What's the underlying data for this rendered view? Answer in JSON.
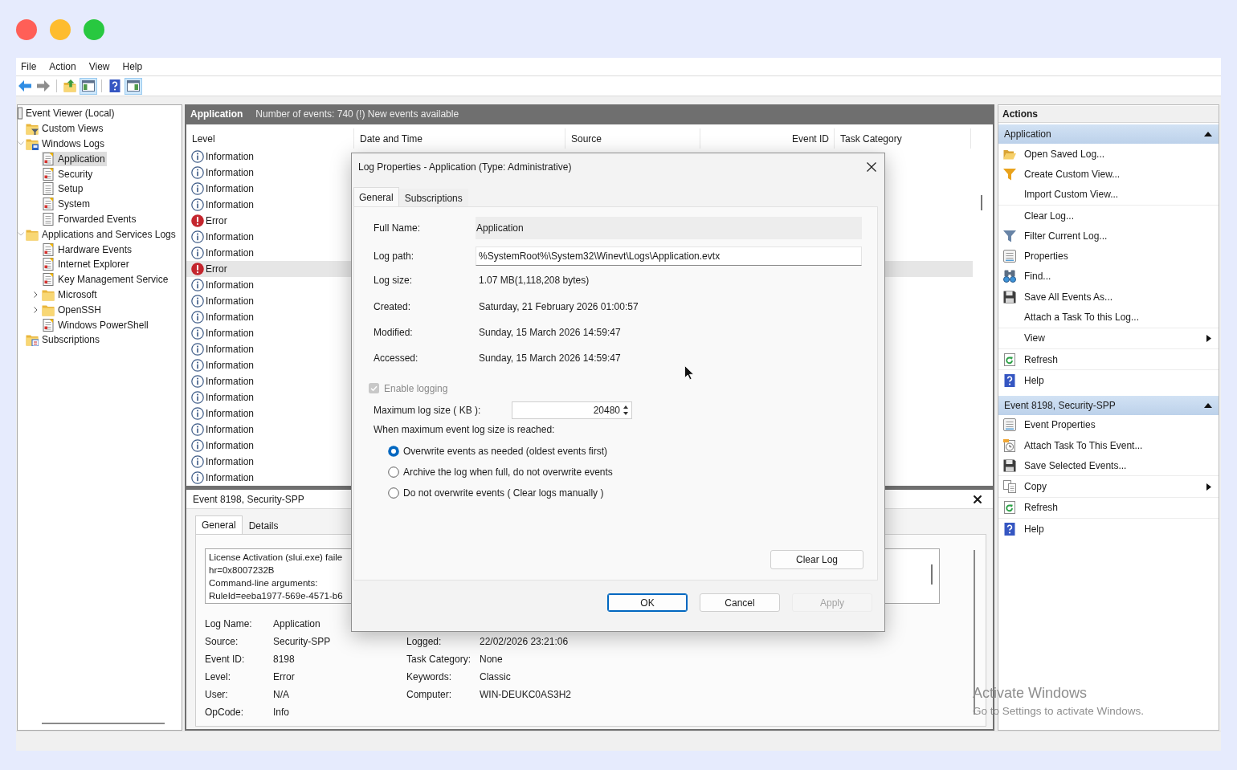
{
  "window_controls": [
    {
      "color": "#ff5f57"
    },
    {
      "color": "#febc2e"
    },
    {
      "color": "#28c840"
    }
  ],
  "menu_bar": [
    {
      "label": "File"
    },
    {
      "label": "Action"
    },
    {
      "label": "View"
    },
    {
      "label": "Help"
    }
  ],
  "toolbar": [
    {
      "pressed": false
    },
    {
      "pressed": false
    },
    {
      "pressed": false
    },
    {
      "pressed": true
    },
    {
      "pressed": false
    },
    {
      "pressed": true
    }
  ],
  "tree": {
    "label": "Event Viewer (Local)",
    "kind": "root",
    "selected": false,
    "children": [
      {
        "label": "Custom Views",
        "kind": "view-folder",
        "selected": false
      },
      {
        "label": "Windows Logs",
        "kind": "logs-folder",
        "selected": false,
        "expanded": true,
        "children": [
          {
            "label": "Application",
            "kind": "log",
            "selected": true
          },
          {
            "label": "Security",
            "kind": "log",
            "selected": false
          },
          {
            "label": "Setup",
            "kind": "blank-log",
            "selected": false
          },
          {
            "label": "System",
            "kind": "log",
            "selected": false
          },
          {
            "label": "Forwarded Events",
            "kind": "blank-log",
            "selected": false
          }
        ]
      },
      {
        "label": "Applications and Services Logs",
        "kind": "folder",
        "selected": false,
        "expanded": true,
        "children": [
          {
            "label": "Hardware Events",
            "kind": "log",
            "selected": false
          },
          {
            "label": "Internet Explorer",
            "kind": "log",
            "selected": false
          },
          {
            "label": "Key Management Service",
            "kind": "log",
            "selected": false
          },
          {
            "label": "Microsoft",
            "kind": "folder",
            "selected": false,
            "expanded": false
          },
          {
            "label": "OpenSSH",
            "kind": "folder",
            "selected": false,
            "expanded": false
          },
          {
            "label": "Windows PowerShell",
            "kind": "log",
            "selected": false
          }
        ]
      },
      {
        "label": "Subscriptions",
        "kind": "subscriptions",
        "selected": false
      }
    ]
  },
  "events_header": {
    "title": "Application",
    "summary": "Number of events: 740 (!) New events available"
  },
  "event_list": {
    "columns": [
      "Level",
      "Date and Time",
      "Source",
      "Event ID",
      "Task Category"
    ],
    "rows": [
      {
        "kind": "information",
        "text": "Information",
        "selected": false
      },
      {
        "kind": "information",
        "text": "Information",
        "selected": false
      },
      {
        "kind": "information",
        "text": "Information",
        "selected": false
      },
      {
        "kind": "information",
        "text": "Information",
        "selected": false
      },
      {
        "kind": "error",
        "text": "Error",
        "selected": false
      },
      {
        "kind": "information",
        "text": "Information",
        "selected": false
      },
      {
        "kind": "information",
        "text": "Information",
        "selected": false
      },
      {
        "kind": "error",
        "text": "Error",
        "selected": true
      },
      {
        "kind": "information",
        "text": "Information",
        "selected": false
      },
      {
        "kind": "information",
        "text": "Information",
        "selected": false
      },
      {
        "kind": "information",
        "text": "Information",
        "selected": false
      },
      {
        "kind": "information",
        "text": "Information",
        "selected": false
      },
      {
        "kind": "information",
        "text": "Information",
        "selected": false
      },
      {
        "kind": "information",
        "text": "Information",
        "selected": false
      },
      {
        "kind": "information",
        "text": "Information",
        "selected": false
      },
      {
        "kind": "information",
        "text": "Information",
        "selected": false
      },
      {
        "kind": "information",
        "text": "Information",
        "selected": false
      },
      {
        "kind": "information",
        "text": "Information",
        "selected": false
      },
      {
        "kind": "information",
        "text": "Information",
        "selected": false
      },
      {
        "kind": "information",
        "text": "Information",
        "selected": false
      },
      {
        "kind": "information",
        "text": "Information",
        "selected": false
      }
    ]
  },
  "event_detail": {
    "title": "Event 8198, Security-SPP",
    "tabs": [
      {
        "label": "General",
        "selected": true
      },
      {
        "label": "Details",
        "selected": false
      }
    ],
    "message": [
      "License Activation (slui.exe) faile",
      "hr=0x8007232B",
      "Command-line arguments:",
      "RuleId=eeba1977-569e-4571-b6"
    ],
    "fields_left": [
      {
        "label": "Log Name:",
        "value": "Application"
      },
      {
        "label": "Source:",
        "value": "Security-SPP"
      },
      {
        "label": "Event ID:",
        "value": "8198"
      },
      {
        "label": "Level:",
        "value": "Error"
      },
      {
        "label": "User:",
        "value": "N/A"
      },
      {
        "label": "OpCode:",
        "value": "Info"
      }
    ],
    "fields_right": [
      {
        "label": "Logged:",
        "value": "22/02/2026 23:21:06"
      },
      {
        "label": "Task Category:",
        "value": "None"
      },
      {
        "label": "Keywords:",
        "value": "Classic"
      },
      {
        "label": "Computer:",
        "value": "WIN-DEUKC0AS3H2"
      }
    ]
  },
  "actions": {
    "title": "Actions",
    "sections": [
      {
        "title": "Application",
        "expanded": true,
        "groups": [
          [
            {
              "label": "Open Saved Log...",
              "submenu": false
            },
            {
              "label": "Create Custom View...",
              "submenu": false
            },
            {
              "label": "Import Custom View...",
              "submenu": false
            }
          ],
          [
            {
              "label": "Clear Log...",
              "submenu": false
            },
            {
              "label": "Filter Current Log...",
              "submenu": false
            },
            {
              "label": "Properties",
              "submenu": false
            },
            {
              "label": "Find...",
              "submenu": false
            },
            {
              "label": "Save All Events As...",
              "submenu": false
            },
            {
              "label": "Attach a Task To this Log...",
              "submenu": false
            }
          ],
          [
            {
              "label": "View",
              "submenu": true
            }
          ],
          [
            {
              "label": "Refresh",
              "submenu": false
            }
          ],
          [
            {
              "label": "Help",
              "submenu": false
            }
          ]
        ]
      },
      {
        "title": "Event 8198, Security-SPP",
        "expanded": true,
        "groups": [
          [
            {
              "label": "Event Properties",
              "submenu": false
            },
            {
              "label": "Attach Task To This Event...",
              "submenu": false
            },
            {
              "label": "Save Selected Events...",
              "submenu": false
            }
          ],
          [
            {
              "label": "Copy",
              "submenu": true
            }
          ],
          [
            {
              "label": "Refresh",
              "submenu": false
            }
          ],
          [
            {
              "label": "Help",
              "submenu": false
            }
          ]
        ]
      }
    ]
  },
  "dialog": {
    "title": "Log Properties - Application (Type: Administrative)",
    "tabs": [
      {
        "label": "General",
        "selected": true
      },
      {
        "label": "Subscriptions",
        "selected": false
      }
    ],
    "full_name": {
      "label": "Full Name:",
      "value": "Application"
    },
    "log_path": {
      "label": "Log path:",
      "value": "%SystemRoot%\\System32\\Winevt\\Logs\\Application.evtx"
    },
    "details": [
      {
        "label": "Log size:",
        "value": "1.07 MB(1,118,208 bytes)"
      },
      {
        "label": "Created:",
        "value": "Saturday, 21 February 2026 01:00:57"
      },
      {
        "label": "Modified:",
        "value": "Sunday, 15 March 2026 14:59:47"
      },
      {
        "label": "Accessed:",
        "value": "Sunday, 15 March 2026 14:59:47"
      }
    ],
    "enable_logging": {
      "label": "Enable logging",
      "checked": true,
      "disabled": true
    },
    "max_log_size": {
      "label": "Maximum log size ( KB ):",
      "value": "20480"
    },
    "retention_prompt": "When maximum event log size is reached:",
    "retention_options": [
      {
        "label": "Overwrite events as needed (oldest events first)",
        "selected": true
      },
      {
        "label": "Archive the log when full, do not overwrite events",
        "selected": false
      },
      {
        "label": "Do not overwrite events ( Clear logs manually )",
        "selected": false
      }
    ],
    "clear_log_button": "Clear Log",
    "buttons": [
      {
        "label": "OK",
        "default": true,
        "disabled": false
      },
      {
        "label": "Cancel",
        "default": false,
        "disabled": false
      },
      {
        "label": "Apply",
        "default": false,
        "disabled": true
      }
    ]
  },
  "activation_notice": {
    "title": "Activate Windows",
    "subtitle": "Go to Settings to activate Windows."
  }
}
